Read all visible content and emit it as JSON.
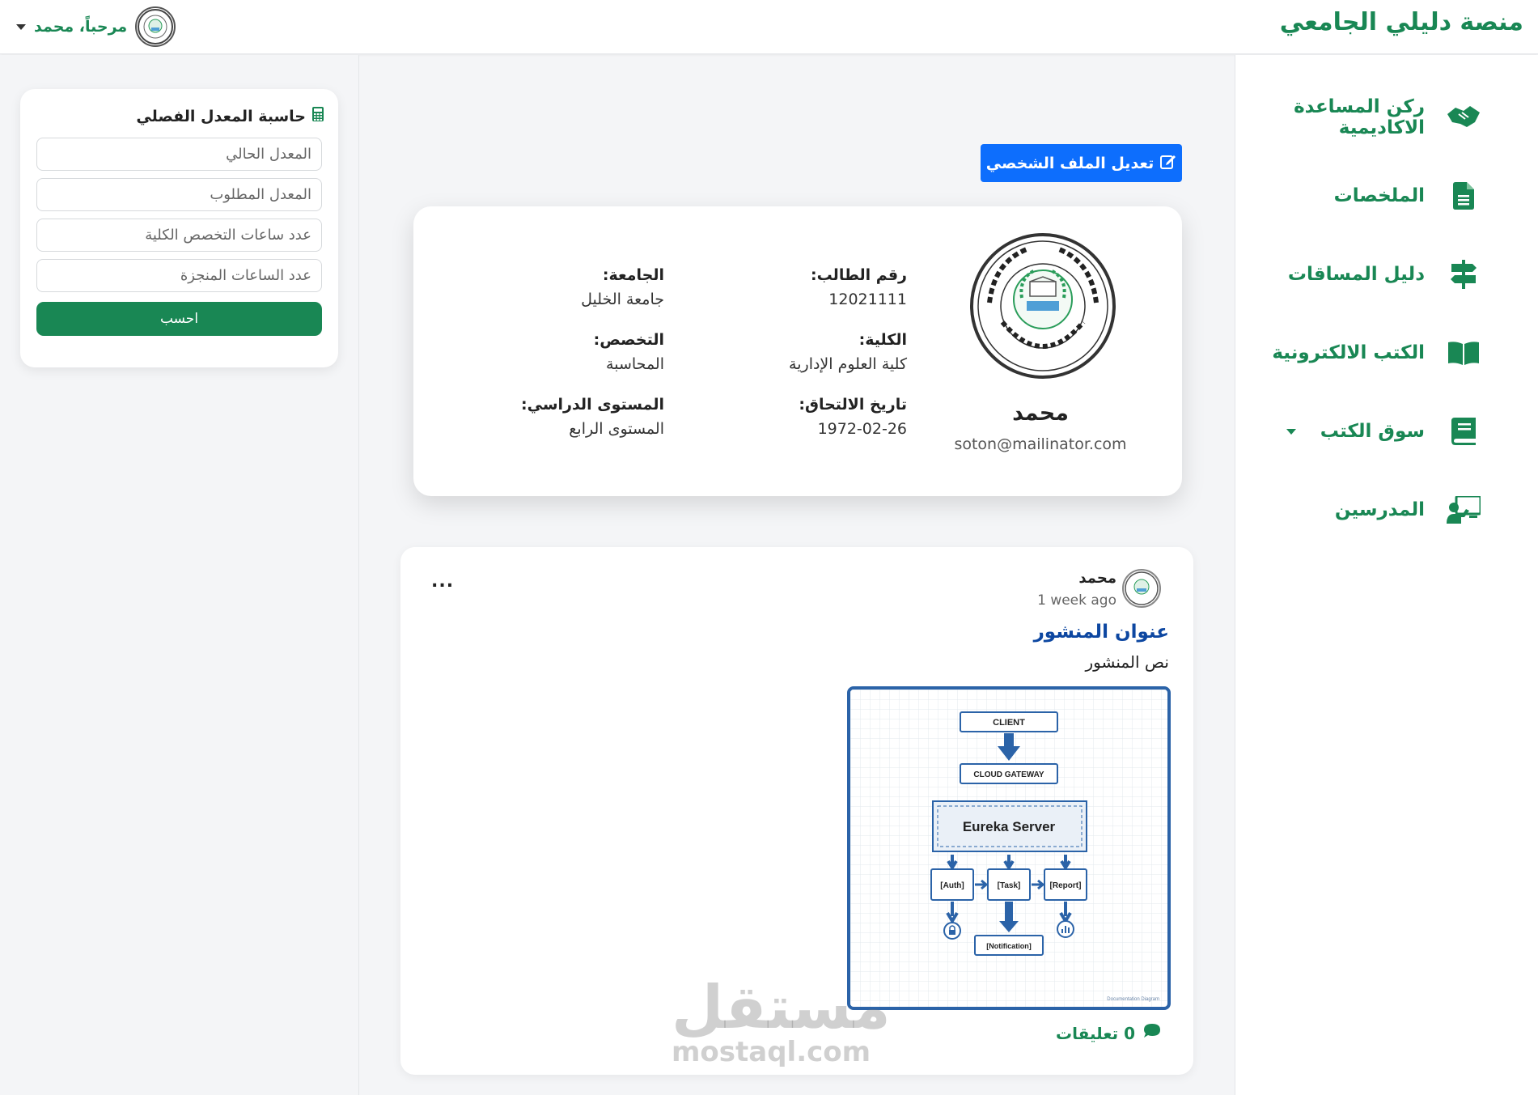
{
  "app": {
    "brand": "منصة دليلي الجامعي"
  },
  "user": {
    "greeting": "مرحباً، محمد"
  },
  "sidebar": {
    "items": [
      {
        "label": "ركن المساعدة الاكاديمية",
        "icon": "handshake-icon"
      },
      {
        "label": "الملخصات",
        "icon": "file-lines-icon"
      },
      {
        "label": "دليل المساقات",
        "icon": "signpost-icon"
      },
      {
        "label": "الكتب الالكترونية",
        "icon": "open-book-icon"
      },
      {
        "label": "سوق الكتب",
        "icon": "book-icon",
        "dropdown": true
      },
      {
        "label": "المدرسين",
        "icon": "teacher-icon"
      }
    ]
  },
  "calculator": {
    "title": "حاسبة المعدل الفصلي",
    "icon": "calculator-icon",
    "fields": [
      {
        "placeholder": "المعدل الحالي",
        "value": ""
      },
      {
        "placeholder": "المعدل المطلوب",
        "value": ""
      },
      {
        "placeholder": "عدد ساعات التخصص الكلية",
        "value": ""
      },
      {
        "placeholder": "عدد الساعات المنجزة",
        "value": ""
      }
    ],
    "submit_label": "احسب"
  },
  "profile": {
    "edit_label": "تعديل الملف الشخصي",
    "name": "محمد",
    "email": "soton@mailinator.com",
    "logo_text": "Islamic University of Gaza",
    "fields": [
      {
        "label": "رقم الطالب:",
        "value": "12021111"
      },
      {
        "label": "الجامعة:",
        "value": "جامعة الخليل"
      },
      {
        "label": "الكلية:",
        "value": "كلية العلوم الإدارية"
      },
      {
        "label": "التخصص:",
        "value": "المحاسبة"
      },
      {
        "label": "تاريخ الالتحاق:",
        "value": "1972-02-26"
      },
      {
        "label": "المستوى الدراسي:",
        "value": "المستوى الرابع"
      }
    ]
  },
  "post": {
    "author": "محمد",
    "time": "1 week ago",
    "menu": "...",
    "title": "عنوان المنشور",
    "body": "نص المنشور",
    "comments": "0 تعليقات",
    "diagram": {
      "client": "CLIENT",
      "gateway": "CLOUD GATEWAY",
      "server": "Eureka Server",
      "auth": "[Auth]",
      "task": "[Task]",
      "report": "[Report]",
      "notification": "[Notification]",
      "caption": "Documentation Diagram"
    }
  },
  "watermark": {
    "arabic": "مستقل",
    "latin": "mostaql.com"
  }
}
